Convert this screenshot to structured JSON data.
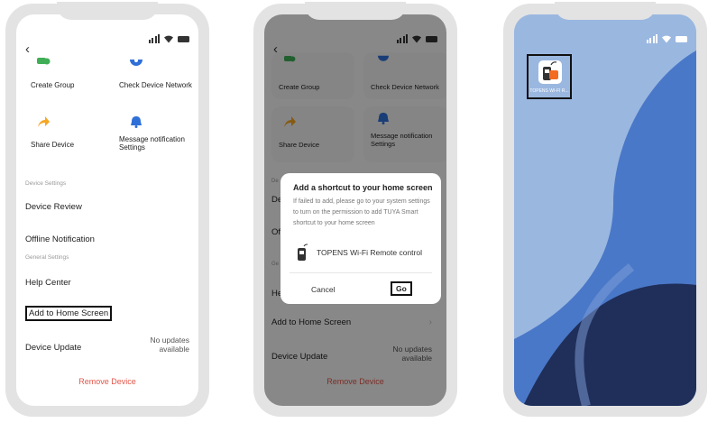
{
  "colors": {
    "accent_green": "#3fae56",
    "accent_blue": "#2f6fd8",
    "accent_orange": "#f5a623",
    "danger": "#e2574c",
    "wallpaper_light": "#9ab7e0",
    "wallpaper_mid": "#4a78c8",
    "wallpaper_dark": "#1f2f5a",
    "app_icon_orange": "#f26b21"
  },
  "phone1": {
    "back_icon": "chevron-left-icon",
    "tiles": [
      {
        "label": "Create Group",
        "icon": "create-group-icon"
      },
      {
        "label": "Check Device Network",
        "icon": "network-icon"
      },
      {
        "label": "Share Device",
        "icon": "share-icon"
      },
      {
        "label": "Message notification Settings",
        "icon": "bell-icon"
      }
    ],
    "device_settings_header": "Device Settings",
    "device_review": "Device Review",
    "offline_notification": "Offline Notification",
    "general_settings_header": "General Settings",
    "help_center": "Help Center",
    "add_to_home": "Add to Home Screen",
    "device_update": "Device Update",
    "no_updates_line1": "No updates",
    "no_updates_line2": "available",
    "remove_device": "Remove Device"
  },
  "phone2": {
    "tiles": [
      {
        "label": "Create Group"
      },
      {
        "label": "Check Device Network"
      },
      {
        "label": "Share Device"
      },
      {
        "label": "Message notification Settings"
      }
    ],
    "partial_de": "De",
    "partial_of": "Of",
    "partial_ge": "Ge",
    "partial_he": "He",
    "add_to_home": "Add to Home Screen",
    "device_update": "Device Update",
    "no_updates_line1": "No updates",
    "no_updates_line2": "available",
    "remove_device": "Remove Device",
    "dialog": {
      "title": "Add a shortcut to your home screen",
      "message": "If failed to add, please go to your system settings to turn on the permission to add TUYA Smart shortcut to your home screen",
      "device_name": "TOPENS Wi-Fi Remote control",
      "cancel": "Cancel",
      "go": "Go"
    }
  },
  "phone3": {
    "app_label": "TOPENS WI-FI R..."
  }
}
